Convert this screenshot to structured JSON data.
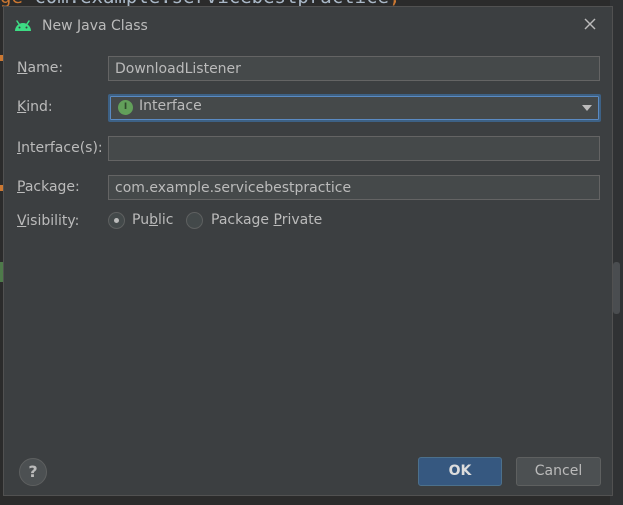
{
  "editor": {
    "code_prefix": "ge ",
    "code_text": "com.example.servicebestpractice",
    "code_suffix": ";"
  },
  "dialog": {
    "title": "New Java Class",
    "icons": {
      "app": "android-icon",
      "close": "close-icon",
      "kind": "interface-kind-icon",
      "help": "help-icon"
    },
    "fields": {
      "name": {
        "label_key": "N",
        "label_rest": "ame:",
        "value": "DownloadListener"
      },
      "kind": {
        "label_key": "K",
        "label_rest": "ind:",
        "value": "Interface",
        "icon_letter": "I"
      },
      "interfaces": {
        "label_key": "I",
        "label_rest": "nterface(s):",
        "value": ""
      },
      "package": {
        "label_key": "P",
        "label_rest": "ackage:",
        "value": "com.example.servicebestpractice"
      },
      "visibility": {
        "label_key": "V",
        "label_rest": "isibility:"
      }
    },
    "visibility_options": [
      {
        "pre": "Pu",
        "key": "b",
        "post": "lic",
        "checked": true
      },
      {
        "pre": "Package ",
        "key": "P",
        "post": "rivate",
        "checked": false
      }
    ],
    "buttons": {
      "help": "?",
      "ok": "OK",
      "cancel": "Cancel"
    },
    "colors": {
      "dialog_bg": "#3c3f41",
      "field_bg": "#45494a",
      "focus_border": "#3d6185",
      "ok_button": "#365880",
      "interface_icon": "#62a05a",
      "android_green": "#3ddc84"
    }
  }
}
